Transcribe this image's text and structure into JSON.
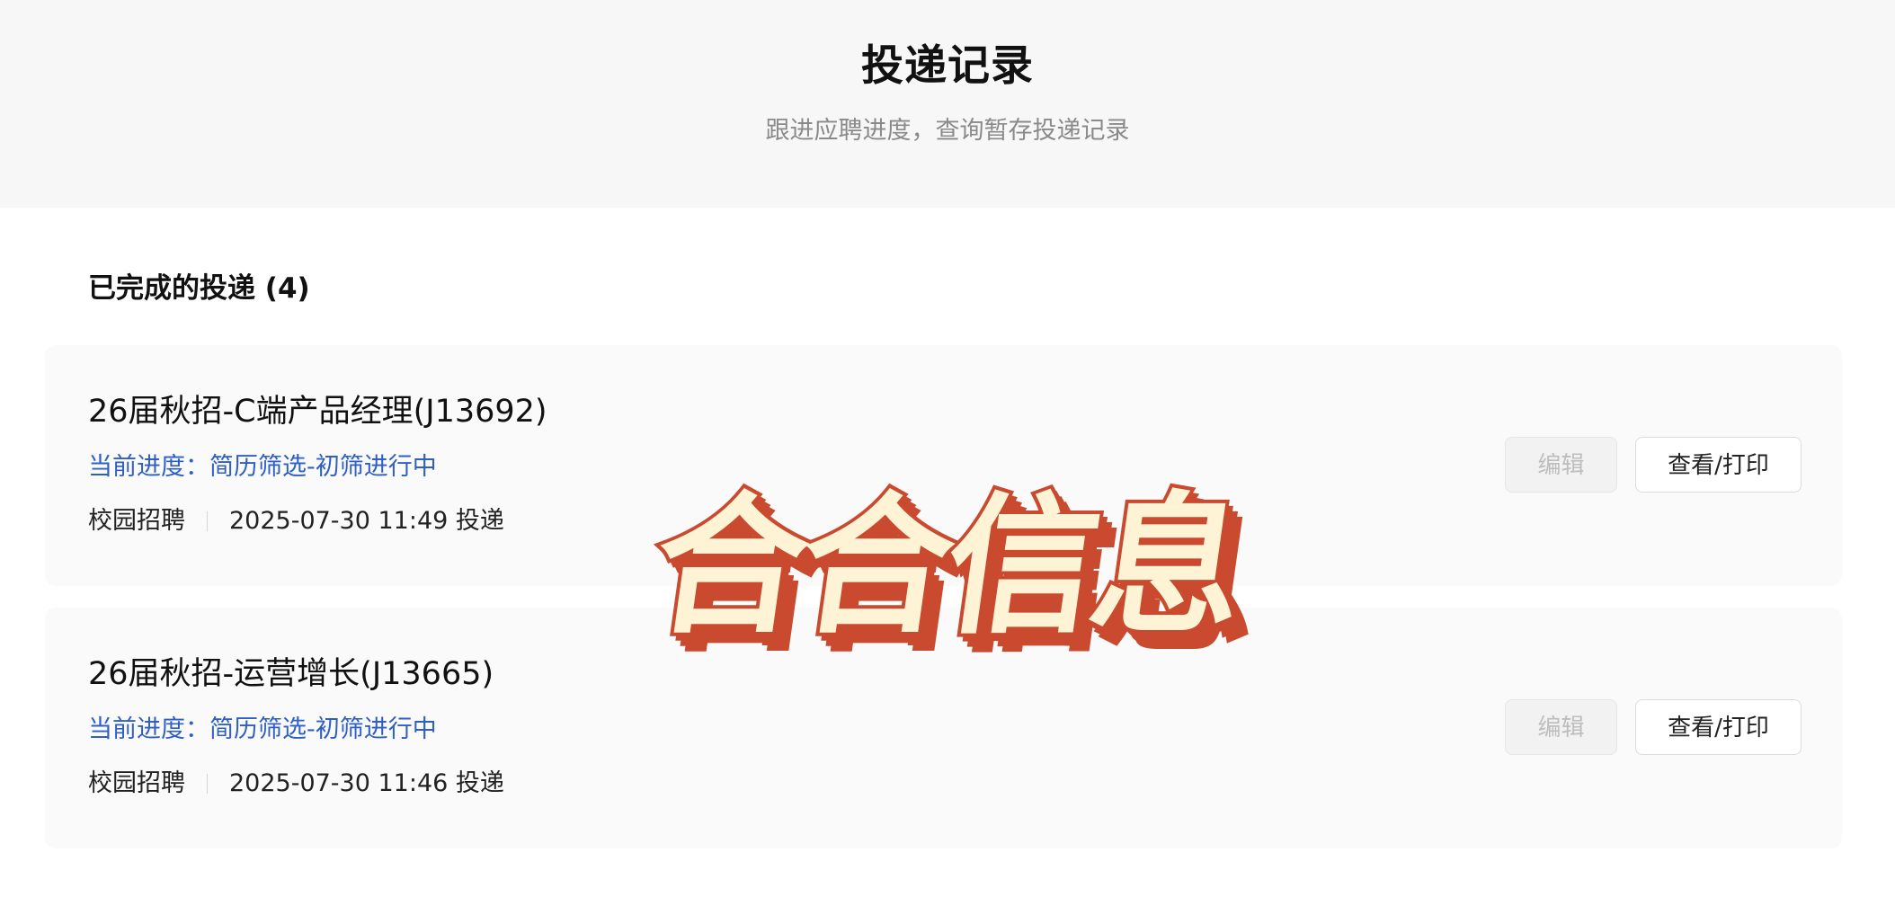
{
  "header": {
    "title": "投递记录",
    "subtitle": "跟进应聘进度，查询暂存投递记录"
  },
  "section": {
    "title": "已完成的投递 (4)"
  },
  "applications": [
    {
      "title": "26届秋招-C端产品经理(J13692)",
      "progress": "当前进度：简历筛选-初筛进行中",
      "channel": "校园招聘",
      "submitted": "2025-07-30 11:49 投递",
      "edit_label": "编辑",
      "view_label": "查看/打印"
    },
    {
      "title": "26届秋招-运营增长(J13665)",
      "progress": "当前进度：简历筛选-初筛进行中",
      "channel": "校园招聘",
      "submitted": "2025-07-30 11:46 投递",
      "edit_label": "编辑",
      "view_label": "查看/打印"
    }
  ],
  "watermark": {
    "text": "合合信息",
    "fill_color": "#fff3d6",
    "stroke_color": "#c94a2e"
  },
  "colors": {
    "progress": "#2f5fc4",
    "header_bg": "#f7f7f7",
    "card_bg": "#fafafa"
  }
}
